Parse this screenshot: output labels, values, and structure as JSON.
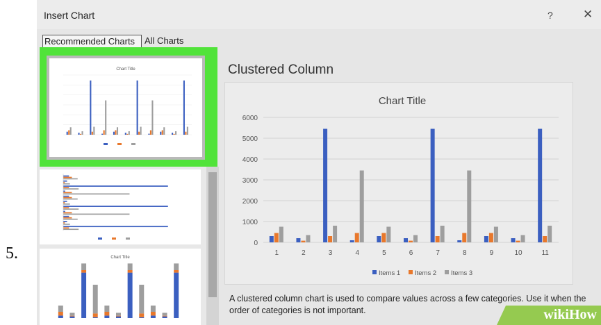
{
  "step": {
    "number": "5."
  },
  "dialog": {
    "title": "Insert Chart",
    "help": "?",
    "close": "✕",
    "tabs": [
      {
        "label": "Recommended Charts"
      },
      {
        "label": "All Charts"
      }
    ]
  },
  "thumbnails": {
    "thumb1_title": "Chart Title",
    "thumb3_title": "Chart Title"
  },
  "preview": {
    "heading": "Clustered Column",
    "description": "A clustered column chart is used to compare values across a few categories. Use it when the order of categories is not important."
  },
  "chart_data": {
    "type": "bar",
    "title": "Chart Title",
    "categories": [
      "1",
      "2",
      "3",
      "4",
      "5",
      "6",
      "7",
      "8",
      "9",
      "10",
      "11"
    ],
    "series": [
      {
        "name": "Items 1",
        "color": "#3b5fc0",
        "values": [
          300,
          200,
          5450,
          100,
          300,
          200,
          5450,
          100,
          300,
          200,
          5450
        ]
      },
      {
        "name": "Items 2",
        "color": "#e8782c",
        "values": [
          450,
          80,
          300,
          450,
          450,
          80,
          300,
          450,
          450,
          80,
          300
        ]
      },
      {
        "name": "Items 3",
        "color": "#9e9e9e",
        "values": [
          750,
          350,
          800,
          3450,
          750,
          350,
          800,
          3450,
          750,
          350,
          800
        ]
      }
    ],
    "ylim": [
      0,
      6000
    ],
    "yticks": [
      "0",
      "1000",
      "2000",
      "3000",
      "4000",
      "5000",
      "6000"
    ],
    "grid": true,
    "legend": "bottom"
  },
  "watermark": {
    "text": "wikiHow"
  }
}
